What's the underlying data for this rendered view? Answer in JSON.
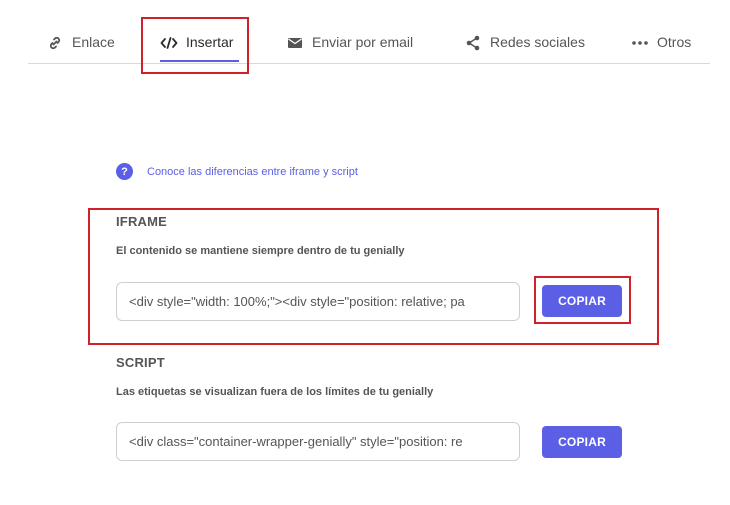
{
  "tabs": [
    {
      "label": "Enlace",
      "icon": "link-icon"
    },
    {
      "label": "Insertar",
      "icon": "code-icon"
    },
    {
      "label": "Enviar por email",
      "icon": "email-icon"
    },
    {
      "label": "Redes sociales",
      "icon": "share-icon"
    },
    {
      "label": "Otros",
      "icon": "more-dots-icon"
    }
  ],
  "help": {
    "icon": "question-circle-icon",
    "link_text": "Conoce las diferencias entre iframe y script"
  },
  "iframe": {
    "title": "IFRAME",
    "description": "El contenido se mantiene siempre dentro de tu genially",
    "code": "<div style=\"width: 100%;\"><div style=\"position: relative; pa",
    "copy_label": "COPIAR"
  },
  "script": {
    "title": "SCRIPT",
    "description": "Las etiquetas se visualizan fuera de los límites de tu genially",
    "code": "<div class=\"container-wrapper-genially\" style=\"position: re",
    "copy_label": "COPIAR"
  },
  "colors": {
    "accent": "#5b5fe6",
    "highlight": "#d0202a"
  }
}
